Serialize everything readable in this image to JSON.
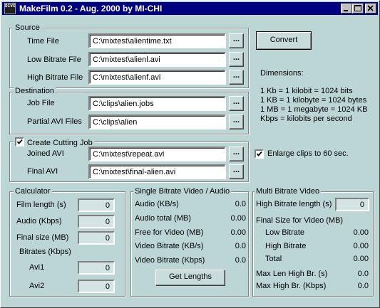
{
  "window": {
    "title": "MakeFilm 0.2 - Aug. 2000 by MI-CHI",
    "app_icon_text": "DIVX"
  },
  "source": {
    "group_label": "Source",
    "time_file_label": "Time File",
    "time_file_value": "C:\\mixtest\\alientime.txt",
    "low_bitrate_label": "Low Bitrate File",
    "low_bitrate_value": "C:\\mixtest\\alienl.avi",
    "high_bitrate_label": "High Bitrate File",
    "high_bitrate_value": "C:\\mixtest\\alienf.avi",
    "browse_label": "..."
  },
  "destination": {
    "group_label": "Destination",
    "job_file_label": "Job File",
    "job_file_value": "C:\\clips\\alien.jobs",
    "partial_label": "Partial AVI Files",
    "partial_value": "C:\\clips\\alien"
  },
  "cutting": {
    "checkbox_label": "Create Cutting Job",
    "checked": true,
    "joined_label": "Joined AVI",
    "joined_value": "C:\\mixtest\\repeat.avi",
    "final_label": "Final AVI",
    "final_value": "C:\\mixtest\\final-alien.avi"
  },
  "convert_label": "Convert",
  "dimensions": {
    "title": "Dimensions:",
    "lines": [
      "1 Kb = 1 kilobit = 1024 bits",
      "1 KB = 1 kilobyte = 1024 bytes",
      "1 MB = 1 megabyte = 1024 KB",
      "Kbps = kilobits per second"
    ]
  },
  "enlarge": {
    "label": "Enlarge clips to 60 sec.",
    "checked": true
  },
  "calculator": {
    "group_label": "Calculator",
    "film_length_label": "Film length (s)",
    "film_length_value": "0",
    "audio_label": "Audio (Kbps)",
    "audio_value": "0",
    "final_size_label": "Final size (MB)",
    "final_size_value": "0",
    "bitrates_label": "Bitrates (Kbps)",
    "avi1_label": "Avi1",
    "avi1_value": "0",
    "avi2_label": "Avi2",
    "avi2_value": "0"
  },
  "single": {
    "group_label": "Single Bitrate Video / Audio",
    "rows": [
      {
        "label": "Audio (KB/s)",
        "value": "0.0"
      },
      {
        "label": "Audio total (MB)",
        "value": "0.00"
      },
      {
        "label": "Free for Video (MB)",
        "value": "0.00"
      },
      {
        "label": "Video Bitrate (KB/s)",
        "value": "0.0"
      },
      {
        "label": "Video Bitrate (Kbps)",
        "value": "0.0"
      }
    ],
    "get_lengths_label": "Get Lengths"
  },
  "multi": {
    "group_label": "Multi Bitrate Video",
    "high_length_label": "High Bitrate length (s)",
    "high_length_value": "0",
    "final_size_label": "Final Size for Video (MB)",
    "rows": [
      {
        "label": "Low Bitrate",
        "value": "0.00"
      },
      {
        "label": "High Bitrate",
        "value": "0.00"
      },
      {
        "label": "Total",
        "value": "0.00"
      }
    ],
    "max_len_label": "Max Len High Br. (s)",
    "max_len_value": "0.0",
    "max_high_label": "Max High Br. (Kbps)",
    "max_high_value": "0.0"
  }
}
